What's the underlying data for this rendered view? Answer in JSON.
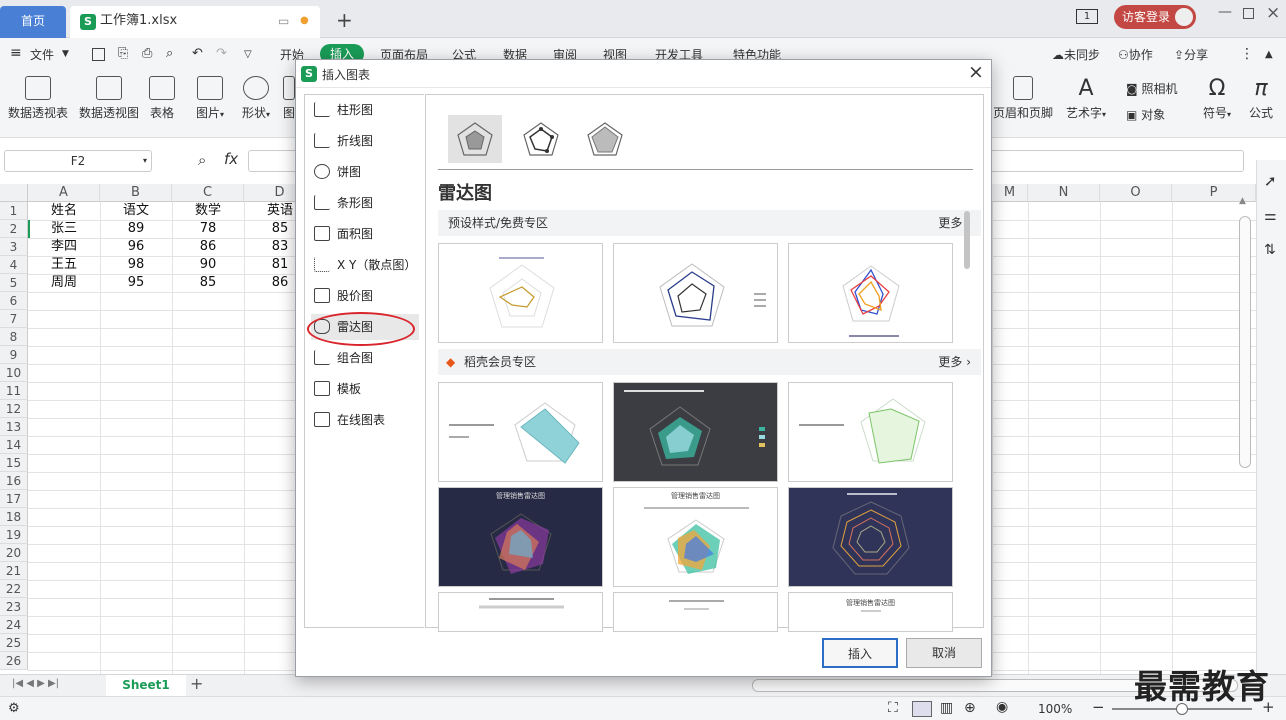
{
  "titlebar": {
    "home_tab": "首页",
    "file_tab": "工作簿1.xlsx",
    "page_badge": "1",
    "guest_login": "访客登录"
  },
  "menu": {
    "file": "文件",
    "items": [
      "开始",
      "插入",
      "页面布局",
      "公式",
      "数据",
      "审阅",
      "视图",
      "开发工具",
      "特色功能"
    ],
    "search": "查找",
    "sync": "未同步",
    "collab": "协作",
    "share": "分享"
  },
  "ribbon": {
    "left": [
      "数据透视表",
      "数据透视图",
      "表格",
      "图片",
      "形状",
      "图"
    ],
    "right": [
      "页眉和页脚",
      "艺术字",
      "照相机",
      "对象",
      "符号",
      "公式"
    ]
  },
  "formula_bar": {
    "cell_ref": "F2",
    "fx": "fx"
  },
  "sheet": {
    "columns": [
      "A",
      "B",
      "C",
      "D",
      "M",
      "N",
      "O",
      "P"
    ],
    "rows": [
      "1",
      "2",
      "3",
      "4",
      "5",
      "6",
      "7",
      "8",
      "9",
      "10",
      "11",
      "12",
      "13",
      "14",
      "15",
      "16",
      "17",
      "18",
      "19",
      "20",
      "21",
      "22",
      "23",
      "24",
      "25",
      "26"
    ],
    "headers": [
      "姓名",
      "语文",
      "数学",
      "英语"
    ],
    "data": [
      [
        "张三",
        "89",
        "78",
        "85"
      ],
      [
        "李四",
        "96",
        "86",
        "83"
      ],
      [
        "王五",
        "98",
        "90",
        "81"
      ],
      [
        "周周",
        "95",
        "85",
        "86"
      ]
    ],
    "tab": "Sheet1",
    "zoom": "100%"
  },
  "dialog": {
    "title": "插入图表",
    "categories": [
      "柱形图",
      "折线图",
      "饼图",
      "条形图",
      "面积图",
      "X Y（散点图）",
      "股价图",
      "雷达图",
      "组合图",
      "模板",
      "在线图表"
    ],
    "selected_category": "雷达图",
    "heading": "雷达图",
    "section_free": "预设样式/免费专区",
    "section_member": "稻壳会员专区",
    "more": "更多",
    "thumb_titles": [
      "管理销售雷达图",
      "管理销售雷达图",
      "管理销售雷达图",
      "管理销售雷达图"
    ],
    "insert_button": "插入",
    "cancel_button": "取消"
  },
  "watermark": "最需教育",
  "colors": {
    "accent_green": "#1a9c57",
    "home_tab_blue": "#4a7fd6",
    "guest_red": "#c34742",
    "highlight_red": "#d9262c",
    "insert_border": "#2b6cc4"
  }
}
